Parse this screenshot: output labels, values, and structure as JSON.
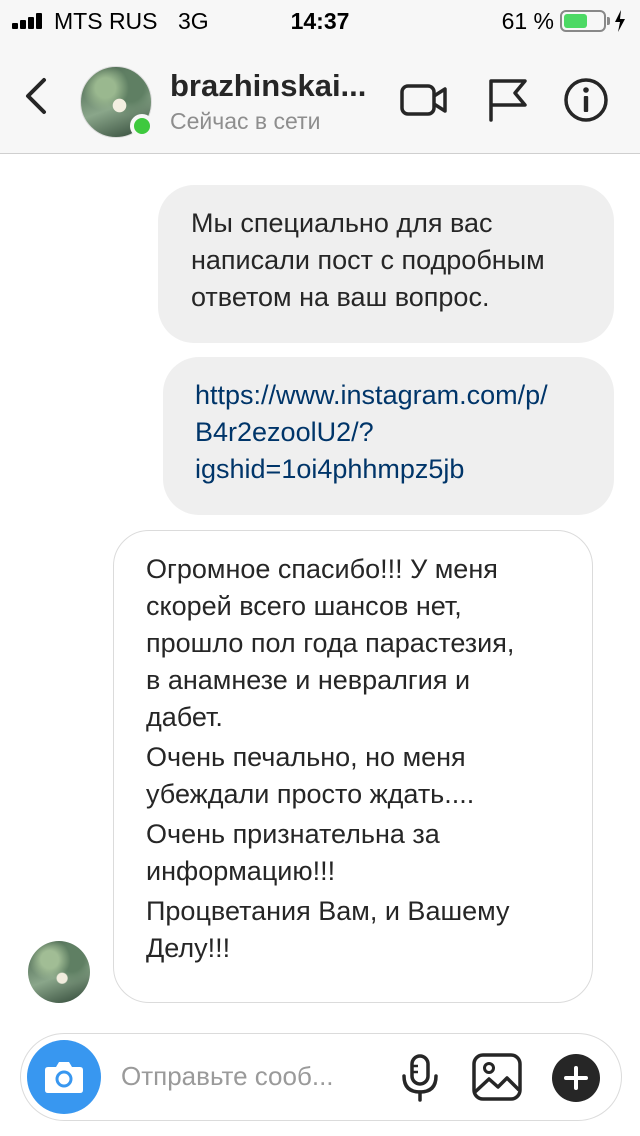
{
  "status_bar": {
    "carrier": "MTS RUS",
    "network": "3G",
    "time": "14:37",
    "battery_percent": "61 %",
    "battery_level": 0.61,
    "battery_color": "#4cd964"
  },
  "header": {
    "back_icon": "chevron-left-icon",
    "contact_name": "brazhinskai...",
    "contact_status": "Сейчас в сети",
    "online_color": "#3ec93e",
    "icons": [
      "video-camera-icon",
      "flag-icon",
      "info-icon"
    ]
  },
  "messages": [
    {
      "direction": "outgoing",
      "lines": [
        "Мы специально для вас",
        "написали пост с подробным",
        "ответом на ваш вопрос."
      ]
    },
    {
      "direction": "outgoing",
      "is_link": true,
      "lines": [
        "https://www.instagram.com/p/",
        "B4r2ezoolU2/?",
        "igshid=1oi4phhmpz5jb"
      ]
    },
    {
      "direction": "incoming",
      "paragraphs": [
        [
          "Огромное спасибо!!! У меня",
          "скорей всего шансов нет,",
          "прошло пол года парастезия,",
          "в анамнезе и невралгия и",
          "дабет."
        ],
        [
          "Очень печально, но меня",
          "убеждали просто ждать...."
        ],
        [
          "Очень признательна за",
          "информацию!!!"
        ],
        [
          "Процветания Вам, и Вашему",
          "Делу!!!"
        ]
      ]
    }
  ],
  "composer": {
    "placeholder": "Отправьте сооб...",
    "camera_icon": "camera-icon",
    "icons": [
      "microphone-icon",
      "image-icon",
      "plus-icon"
    ],
    "accent": "#3897f0"
  },
  "colors": {
    "outgoing_bubble": "#efefef",
    "link": "#003569",
    "header_bg": "#f7f7f7"
  }
}
